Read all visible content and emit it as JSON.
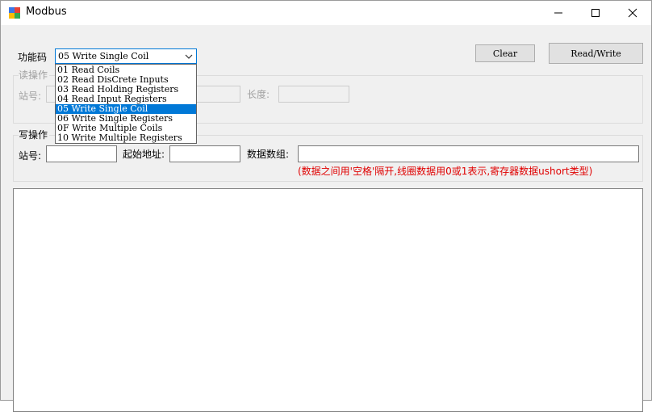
{
  "window": {
    "title": "Modbus",
    "icon": "modbus-app-icon"
  },
  "controls": {
    "minimize_icon": "minimize-icon",
    "maximize_icon": "maximize-icon",
    "close_icon": "close-icon"
  },
  "function_code": {
    "label": "功能码",
    "selected": "05 Write Single Coil",
    "options": [
      "01 Read Coils",
      "02 Read DisCrete Inputs",
      "03 Read Holding Registers",
      "04 Read Input Registers",
      "05 Write Single Coil",
      "06 Write Single Registers",
      "0F Write Multiple Coils",
      "10 Write Multiple Registers"
    ],
    "selected_index": 4
  },
  "buttons": {
    "clear": "Clear",
    "read_write": "Read/Write"
  },
  "read_group": {
    "title": "读操作",
    "station_label": "站号:",
    "length_label": "长度:"
  },
  "write_group": {
    "title": "写操作",
    "station_label": "站号:",
    "start_address_label": "起始地址:",
    "data_group_label": "数据数组:",
    "note": "(数据之间用'空格'隔开,线圈数据用0或1表示,寄存器数据ushort类型)"
  },
  "colors": {
    "accent": "#0078d7",
    "note": "#e00000"
  }
}
